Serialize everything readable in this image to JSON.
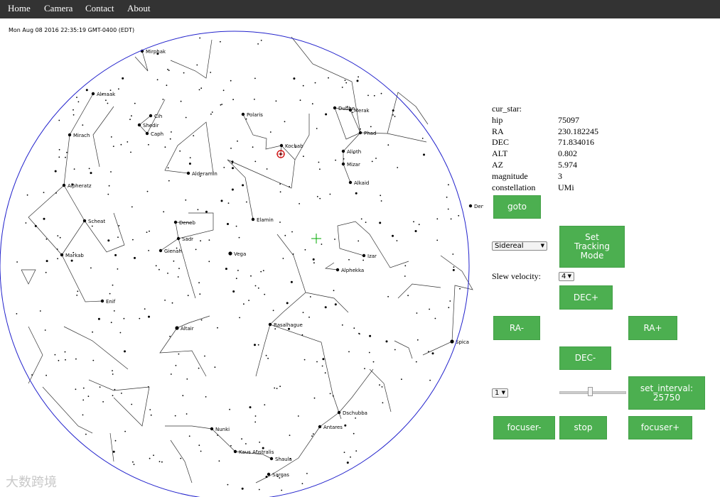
{
  "nav": [
    "Home",
    "Camera",
    "Contact",
    "About"
  ],
  "timestamp": "Mon Aug 08 2016 22:35:19 GMT-0400 (EDT)",
  "info": [
    {
      "key": "cur_star:",
      "value": ""
    },
    {
      "key": "hip",
      "value": "75097"
    },
    {
      "key": "RA",
      "value": "230.182245"
    },
    {
      "key": "DEC",
      "value": "71.834016"
    },
    {
      "key": "ALT",
      "value": "0.802"
    },
    {
      "key": "AZ",
      "value": "5.974"
    },
    {
      "key": "magnitude",
      "value": "3"
    },
    {
      "key": "constellation",
      "value": "UMi"
    }
  ],
  "controls": {
    "goto": "goto",
    "tracking_select": "Sidereal",
    "set_tracking_mode": "Set Tracking Mode",
    "slew_label": "Slew velocity:",
    "slew_select": "4",
    "dec_plus": "DEC+",
    "ra_minus": "RA-",
    "ra_plus": "RA+",
    "dec_minus": "DEC-",
    "focus_select": "1",
    "set_interval": "set_interval: 25750",
    "focuser_minus": "focuser-",
    "stop": "stop",
    "focuser_plus": "focuser+"
  },
  "colors": {
    "navbar": "#333333",
    "button": "#4caf50",
    "horizon": "#2222cc",
    "crosshair": "#00aa00",
    "marker": "#cc0000"
  },
  "star_labels": [
    "Mirphak",
    "Almaak",
    "Cih",
    "Shedir",
    "Caph",
    "Mirach",
    "Alderamin",
    "Alpheratz",
    "Scheat",
    "Deneb",
    "Sadr",
    "Gienah",
    "Markab",
    "Vega",
    "Enif",
    "Altair",
    "Polaris",
    "Kochab",
    "Dubhe",
    "Merak",
    "Phad",
    "Alioth",
    "Mizar",
    "Alkaid",
    "Deneb",
    "Elamin",
    "Izar",
    "Alphekka",
    "Rasalhague",
    "Spica",
    "Dschubba",
    "Antares",
    "Nunki",
    "Kaus Australis",
    "Shaula",
    "Sargas"
  ],
  "watermark": "大数跨境"
}
